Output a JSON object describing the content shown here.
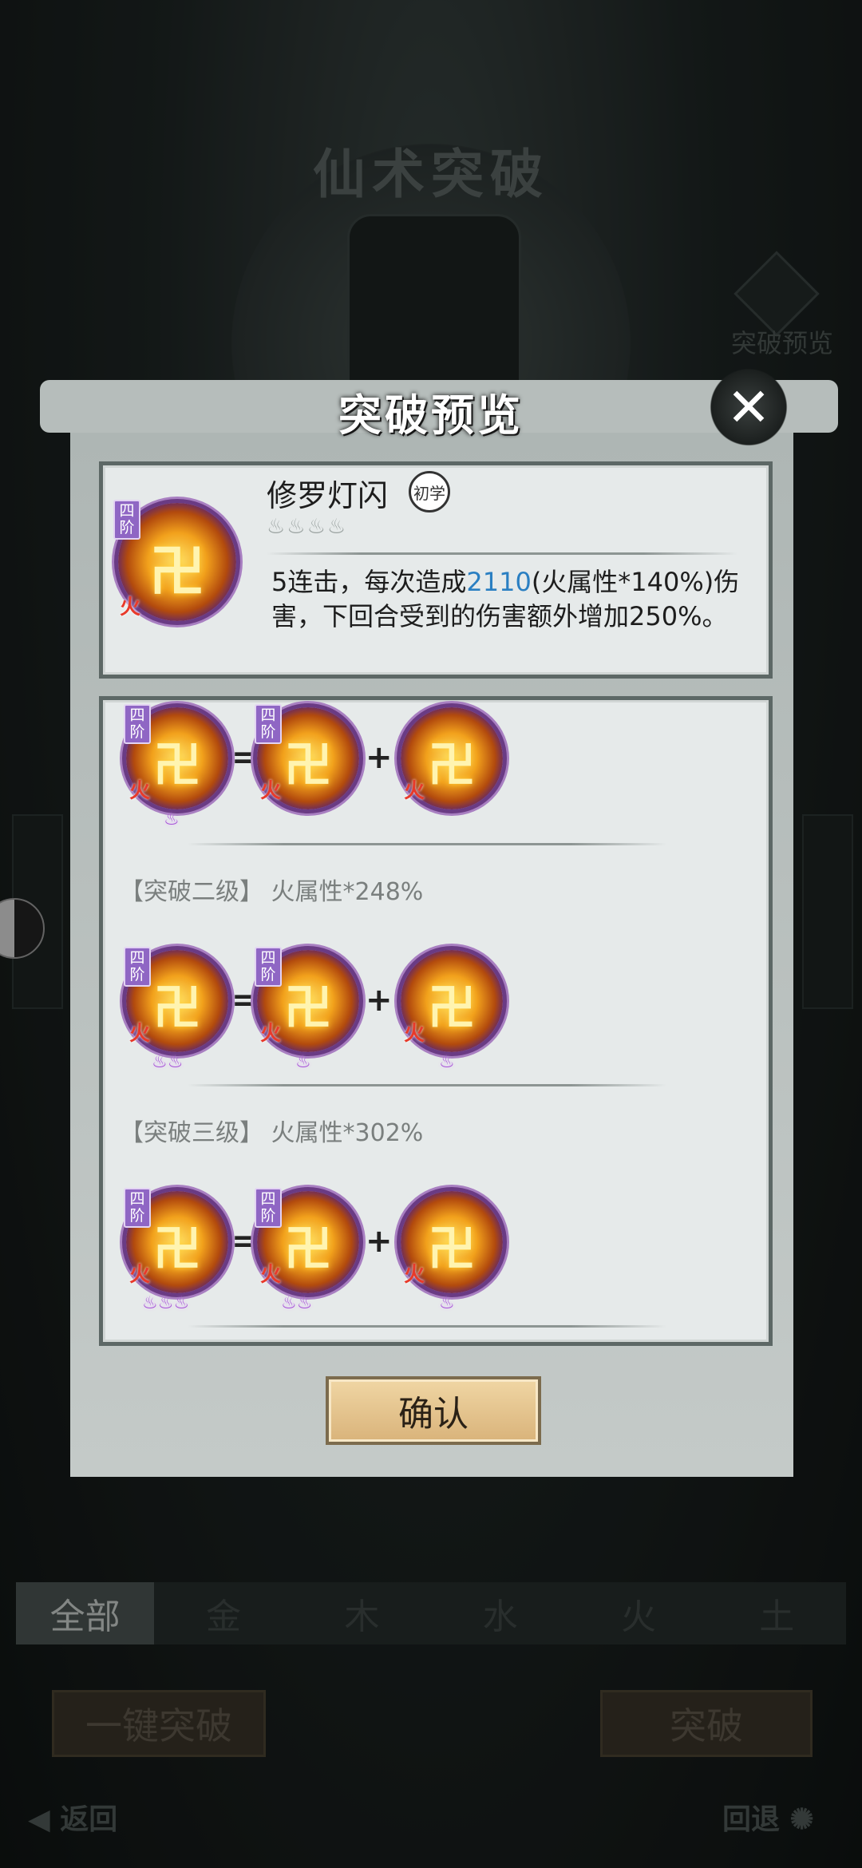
{
  "background": {
    "title": "仙术突破",
    "preview_label": "突破预览",
    "tabs": [
      "全部",
      "金",
      "木",
      "水",
      "火",
      "土"
    ],
    "one_click_button": "一键突破",
    "breakthrough_button": "突破",
    "back_label": "返回",
    "undo_label": "回退"
  },
  "modal": {
    "title": "突破预览",
    "close_icon": "close-icon",
    "skill": {
      "tier": "四阶",
      "element": "火",
      "name": "修罗灯闪",
      "rank_badge": "初学",
      "desc_before": "5连击，每次造成",
      "desc_value": "2110",
      "desc_after": "(火属性*140%)伤害，下回合受到的伤害额外增加250%。"
    },
    "levels": [
      {
        "label": "",
        "result_stars": "♨",
        "a_stars": "",
        "b_stars": ""
      },
      {
        "label": "【突破二级】 火属性*248%",
        "result_stars": "♨♨",
        "a_stars": "♨",
        "b_stars": "♨"
      },
      {
        "label": "【突破三级】 火属性*302%",
        "result_stars": "♨♨♨",
        "a_stars": "♨♨",
        "b_stars": "♨"
      }
    ],
    "equals": "=",
    "plus": "+",
    "confirm_button": "确认"
  }
}
